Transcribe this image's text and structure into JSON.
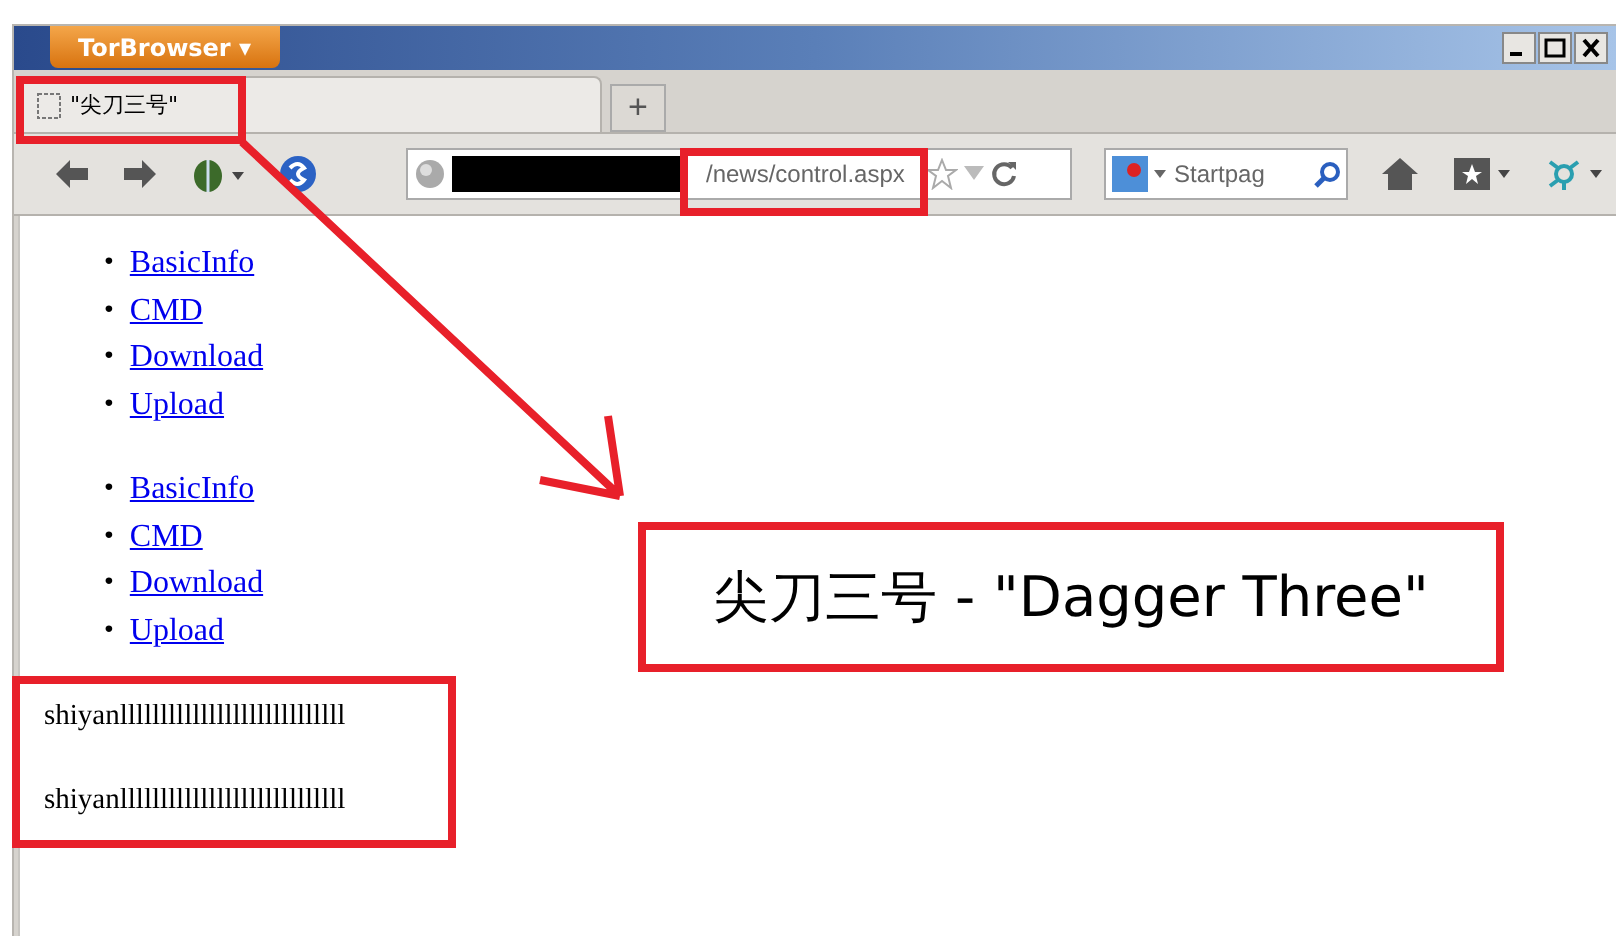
{
  "window": {
    "menu_button": "TorBrowser ▾"
  },
  "tabs": [
    {
      "title": "\"尖刀三号\"",
      "selected": true
    }
  ],
  "new_tab": "+",
  "address_bar": {
    "url": "/news/control.aspx"
  },
  "search": {
    "placeholder": "Startpag"
  },
  "page": {
    "link_lists": [
      [
        {
          "marker": "•",
          "label": "BasicInfo"
        },
        {
          "marker": "•",
          "label": "CMD"
        },
        {
          "marker": "•",
          "label": "Download"
        },
        {
          "marker": "•",
          "label": "Upload"
        }
      ],
      [
        {
          "marker": "•",
          "label": "BasicInfo"
        },
        {
          "marker": "•",
          "label": "CMD"
        },
        {
          "marker": "•",
          "label": "Download"
        },
        {
          "marker": "•",
          "label": "Upload"
        }
      ]
    ],
    "paragraphs": [
      "shiyanllllllllllllllllllllllllllll",
      "shiyanllllllllllllllllllllllllllll"
    ]
  },
  "annotation": {
    "callout": "尖刀三号  - \"Dagger Three\""
  }
}
